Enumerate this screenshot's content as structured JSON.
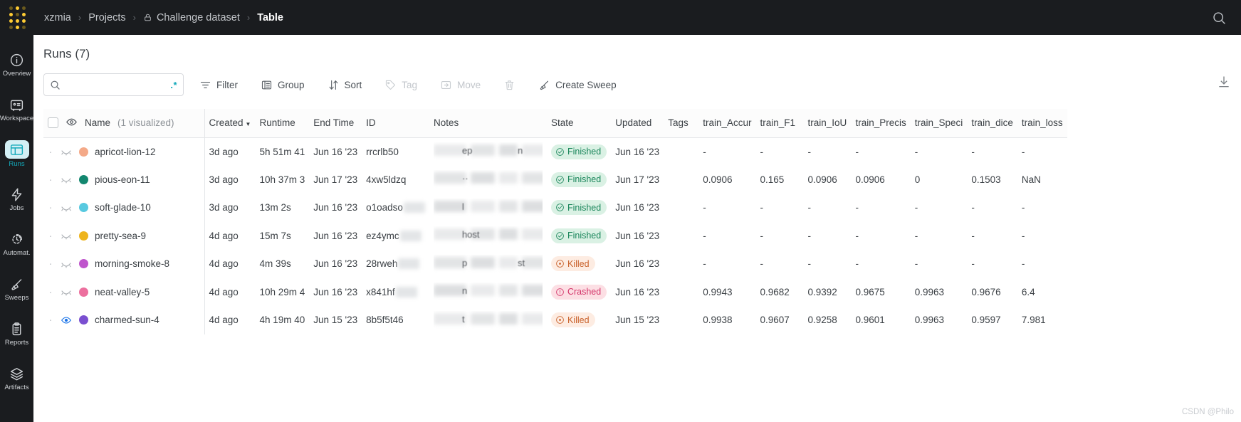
{
  "topbar": {
    "logo_name": "wandb-logo",
    "breadcrumbs": [
      {
        "label": "xzmia",
        "icon": null,
        "current": false
      },
      {
        "label": "Projects",
        "icon": null,
        "current": false
      },
      {
        "label": "Challenge dataset",
        "icon": "lock-icon",
        "current": false
      },
      {
        "label": "Table",
        "icon": null,
        "current": true
      }
    ],
    "separator": "›",
    "search_icon": "search-icon"
  },
  "sidebar": {
    "items": [
      {
        "label": "Overview",
        "icon": "info-circle-icon",
        "active": false
      },
      {
        "label": "Workspace",
        "icon": "workspace-icon",
        "active": false
      },
      {
        "label": "Runs",
        "icon": "table-panel-icon",
        "active": true
      },
      {
        "label": "Jobs",
        "icon": "lightning-icon",
        "active": false
      },
      {
        "label": "Automat.",
        "icon": "automation-icon",
        "active": false
      },
      {
        "label": "Sweeps",
        "icon": "broom-icon",
        "active": false
      },
      {
        "label": "Reports",
        "icon": "clipboard-icon",
        "active": false
      },
      {
        "label": "Artifacts",
        "icon": "layers-icon",
        "active": false
      }
    ]
  },
  "main": {
    "page_title": "Runs (7)",
    "search": {
      "value": "",
      "placeholder": "",
      "icon": "search-icon",
      "regex_icon": ".*"
    },
    "toolbar": [
      {
        "label": "Filter",
        "icon": "filter-icon",
        "disabled": false
      },
      {
        "label": "Group",
        "icon": "group-icon",
        "disabled": false
      },
      {
        "label": "Sort",
        "icon": "sort-icon",
        "disabled": false
      },
      {
        "label": "Tag",
        "icon": "tag-icon",
        "disabled": true
      },
      {
        "label": "Move",
        "icon": "move-icon",
        "disabled": true
      },
      {
        "label": "",
        "icon": "trash-icon",
        "disabled": true
      },
      {
        "label": "Create Sweep",
        "icon": "broom-icon",
        "disabled": false
      }
    ],
    "download_icon": "download-icon"
  },
  "table": {
    "header": {
      "checkbox_checked": false,
      "eye_icon": "eye-icon",
      "name_label": "Name",
      "name_sublabel": "(1 visualized)",
      "columns": [
        {
          "key": "created",
          "label": "Created",
          "sorted": true
        },
        {
          "key": "runtime",
          "label": "Runtime",
          "sorted": false
        },
        {
          "key": "end_time",
          "label": "End Time",
          "sorted": false
        },
        {
          "key": "id",
          "label": "ID",
          "sorted": false
        },
        {
          "key": "notes",
          "label": "Notes",
          "sorted": false
        },
        {
          "key": "state",
          "label": "State",
          "sorted": false
        },
        {
          "key": "updated",
          "label": "Updated",
          "sorted": false
        },
        {
          "key": "tags",
          "label": "Tags",
          "sorted": false
        },
        {
          "key": "m1",
          "label": "train_Accur",
          "sorted": false
        },
        {
          "key": "m2",
          "label": "train_F1",
          "sorted": false
        },
        {
          "key": "m3",
          "label": "train_IoU",
          "sorted": false
        },
        {
          "key": "m4",
          "label": "train_Precis",
          "sorted": false
        },
        {
          "key": "m5",
          "label": "train_Speci",
          "sorted": false
        },
        {
          "key": "m6",
          "label": "train_dice",
          "sorted": false
        },
        {
          "key": "m7",
          "label": "train_loss",
          "sorted": false
        }
      ]
    },
    "rows": [
      {
        "name": "apricot-lion-12",
        "color": "#f4a988",
        "visualized": false,
        "created": "3d ago",
        "runtime": "5h 51m 41",
        "end_time": "Jun 16 '23",
        "id": "rrcrlb50",
        "id_blurred": false,
        "notes_fragments": [
          "ep",
          "n"
        ],
        "state": "Finished",
        "state_kind": "finished",
        "updated": "Jun 16 '23",
        "tags": "",
        "metrics": [
          "-",
          "-",
          "-",
          "-",
          "-",
          "-",
          "-"
        ]
      },
      {
        "name": "pious-eon-11",
        "color": "#13876f",
        "visualized": false,
        "created": "3d ago",
        "runtime": "10h 37m 3",
        "end_time": "Jun 17 '23",
        "id": "4xw5ldzq",
        "id_blurred": false,
        "notes_fragments": [
          "··"
        ],
        "state": "Finished",
        "state_kind": "finished",
        "updated": "Jun 17 '23",
        "tags": "",
        "metrics": [
          "0.0906",
          "0.165",
          "0.0906",
          "0.0906",
          "0",
          "0.1503",
          "NaN"
        ]
      },
      {
        "name": "soft-glade-10",
        "color": "#58c9e0",
        "visualized": false,
        "created": "3d ago",
        "runtime": "13m 2s",
        "end_time": "Jun 16 '23",
        "id": "o1oadso",
        "id_blurred": true,
        "notes_fragments": [
          "l"
        ],
        "state": "Finished",
        "state_kind": "finished",
        "updated": "Jun 16 '23",
        "tags": "",
        "metrics": [
          "-",
          "-",
          "-",
          "-",
          "-",
          "-",
          "-"
        ]
      },
      {
        "name": "pretty-sea-9",
        "color": "#eeb41c",
        "visualized": false,
        "created": "4d ago",
        "runtime": "15m 7s",
        "end_time": "Jun 16 '23",
        "id": "ez4ymc",
        "id_blurred": true,
        "notes_fragments": [
          "host"
        ],
        "state": "Finished",
        "state_kind": "finished",
        "updated": "Jun 16 '23",
        "tags": "",
        "metrics": [
          "-",
          "-",
          "-",
          "-",
          "-",
          "-",
          "-"
        ]
      },
      {
        "name": "morning-smoke-8",
        "color": "#bf55cc",
        "visualized": false,
        "created": "4d ago",
        "runtime": "4m 39s",
        "end_time": "Jun 16 '23",
        "id": "28rweh",
        "id_blurred": true,
        "notes_fragments": [
          "p",
          "st"
        ],
        "state": "Killed",
        "state_kind": "killed",
        "updated": "Jun 16 '23",
        "tags": "",
        "metrics": [
          "-",
          "-",
          "-",
          "-",
          "-",
          "-",
          "-"
        ]
      },
      {
        "name": "neat-valley-5",
        "color": "#ec6f9e",
        "visualized": false,
        "created": "4d ago",
        "runtime": "10h 29m 4",
        "end_time": "Jun 16 '23",
        "id": "x841hf",
        "id_blurred": true,
        "notes_fragments": [
          "n"
        ],
        "state": "Crashed",
        "state_kind": "crashed",
        "updated": "Jun 16 '23",
        "tags": "",
        "metrics": [
          "0.9943",
          "0.9682",
          "0.9392",
          "0.9675",
          "0.9963",
          "0.9676",
          "6.4"
        ]
      },
      {
        "name": "charmed-sun-4",
        "color": "#7a4fd0",
        "visualized": true,
        "created": "4d ago",
        "runtime": "4h 19m 40",
        "end_time": "Jun 15 '23",
        "id": "8b5f5t46",
        "id_blurred": false,
        "notes_fragments": [
          "t"
        ],
        "state": "Killed",
        "state_kind": "killed",
        "updated": "Jun 15 '23",
        "tags": "",
        "metrics": [
          "0.9938",
          "0.9607",
          "0.9258",
          "0.9601",
          "0.9963",
          "0.9597",
          "7.981"
        ]
      }
    ],
    "placeholder_dash": "-"
  },
  "watermark": {
    "text": "CSDN @Philo"
  },
  "colors": {
    "topbar_bg": "#1a1c1f",
    "accent_teal": "#13a9ba",
    "finished_bg": "#daf1e4",
    "finished_fg": "#19855a",
    "killed_bg": "#fdece2",
    "killed_fg": "#c9622c",
    "crashed_bg": "#fcdfe4",
    "crashed_fg": "#d4356a",
    "logo_yellow": "#ffcc33"
  }
}
